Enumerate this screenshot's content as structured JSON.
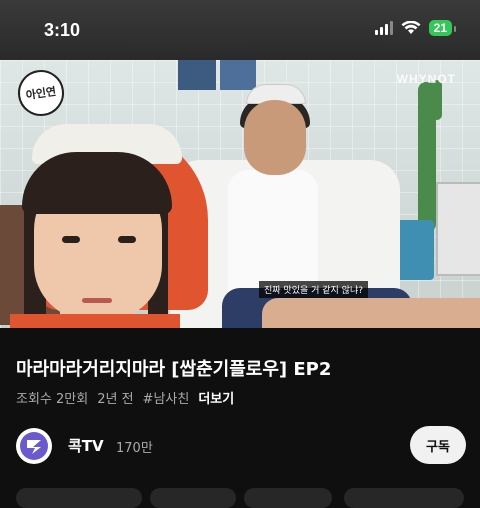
{
  "status_bar": {
    "time": "3:10",
    "battery": "21",
    "icons": [
      "signal-icon",
      "wifi-icon",
      "battery-icon"
    ]
  },
  "video": {
    "channel_badge": "아인연",
    "watermark": "WHYNOT",
    "subtitle": "진짜 맛있을 거 같지 않냐?"
  },
  "details": {
    "title": "마라마라거리지마라 [쌉춘기플로우] EP2",
    "views": "조회수 2만회",
    "age": "2년 전",
    "hashtag": "#남사친",
    "more": "더보기"
  },
  "channel": {
    "name": "콕TV",
    "subscribers": "170만",
    "subscribe_label": "구독",
    "avatar_color": "#6a5acd"
  }
}
